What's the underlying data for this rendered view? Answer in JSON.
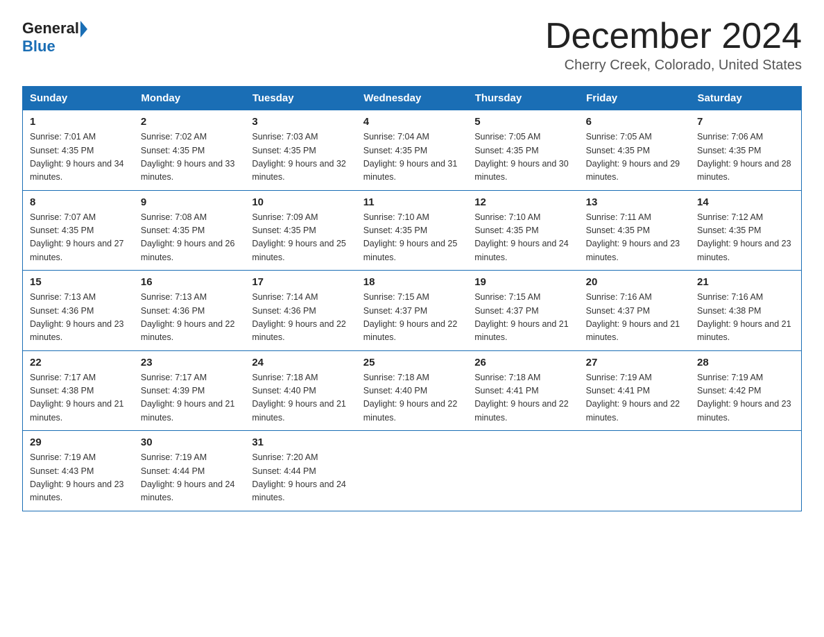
{
  "logo": {
    "general": "General",
    "blue": "Blue"
  },
  "title": "December 2024",
  "subtitle": "Cherry Creek, Colorado, United States",
  "days_of_week": [
    "Sunday",
    "Monday",
    "Tuesday",
    "Wednesday",
    "Thursday",
    "Friday",
    "Saturday"
  ],
  "weeks": [
    [
      {
        "day": "1",
        "sunrise": "7:01 AM",
        "sunset": "4:35 PM",
        "daylight": "9 hours and 34 minutes."
      },
      {
        "day": "2",
        "sunrise": "7:02 AM",
        "sunset": "4:35 PM",
        "daylight": "9 hours and 33 minutes."
      },
      {
        "day": "3",
        "sunrise": "7:03 AM",
        "sunset": "4:35 PM",
        "daylight": "9 hours and 32 minutes."
      },
      {
        "day": "4",
        "sunrise": "7:04 AM",
        "sunset": "4:35 PM",
        "daylight": "9 hours and 31 minutes."
      },
      {
        "day": "5",
        "sunrise": "7:05 AM",
        "sunset": "4:35 PM",
        "daylight": "9 hours and 30 minutes."
      },
      {
        "day": "6",
        "sunrise": "7:05 AM",
        "sunset": "4:35 PM",
        "daylight": "9 hours and 29 minutes."
      },
      {
        "day": "7",
        "sunrise": "7:06 AM",
        "sunset": "4:35 PM",
        "daylight": "9 hours and 28 minutes."
      }
    ],
    [
      {
        "day": "8",
        "sunrise": "7:07 AM",
        "sunset": "4:35 PM",
        "daylight": "9 hours and 27 minutes."
      },
      {
        "day": "9",
        "sunrise": "7:08 AM",
        "sunset": "4:35 PM",
        "daylight": "9 hours and 26 minutes."
      },
      {
        "day": "10",
        "sunrise": "7:09 AM",
        "sunset": "4:35 PM",
        "daylight": "9 hours and 25 minutes."
      },
      {
        "day": "11",
        "sunrise": "7:10 AM",
        "sunset": "4:35 PM",
        "daylight": "9 hours and 25 minutes."
      },
      {
        "day": "12",
        "sunrise": "7:10 AM",
        "sunset": "4:35 PM",
        "daylight": "9 hours and 24 minutes."
      },
      {
        "day": "13",
        "sunrise": "7:11 AM",
        "sunset": "4:35 PM",
        "daylight": "9 hours and 23 minutes."
      },
      {
        "day": "14",
        "sunrise": "7:12 AM",
        "sunset": "4:35 PM",
        "daylight": "9 hours and 23 minutes."
      }
    ],
    [
      {
        "day": "15",
        "sunrise": "7:13 AM",
        "sunset": "4:36 PM",
        "daylight": "9 hours and 23 minutes."
      },
      {
        "day": "16",
        "sunrise": "7:13 AM",
        "sunset": "4:36 PM",
        "daylight": "9 hours and 22 minutes."
      },
      {
        "day": "17",
        "sunrise": "7:14 AM",
        "sunset": "4:36 PM",
        "daylight": "9 hours and 22 minutes."
      },
      {
        "day": "18",
        "sunrise": "7:15 AM",
        "sunset": "4:37 PM",
        "daylight": "9 hours and 22 minutes."
      },
      {
        "day": "19",
        "sunrise": "7:15 AM",
        "sunset": "4:37 PM",
        "daylight": "9 hours and 21 minutes."
      },
      {
        "day": "20",
        "sunrise": "7:16 AM",
        "sunset": "4:37 PM",
        "daylight": "9 hours and 21 minutes."
      },
      {
        "day": "21",
        "sunrise": "7:16 AM",
        "sunset": "4:38 PM",
        "daylight": "9 hours and 21 minutes."
      }
    ],
    [
      {
        "day": "22",
        "sunrise": "7:17 AM",
        "sunset": "4:38 PM",
        "daylight": "9 hours and 21 minutes."
      },
      {
        "day": "23",
        "sunrise": "7:17 AM",
        "sunset": "4:39 PM",
        "daylight": "9 hours and 21 minutes."
      },
      {
        "day": "24",
        "sunrise": "7:18 AM",
        "sunset": "4:40 PM",
        "daylight": "9 hours and 21 minutes."
      },
      {
        "day": "25",
        "sunrise": "7:18 AM",
        "sunset": "4:40 PM",
        "daylight": "9 hours and 22 minutes."
      },
      {
        "day": "26",
        "sunrise": "7:18 AM",
        "sunset": "4:41 PM",
        "daylight": "9 hours and 22 minutes."
      },
      {
        "day": "27",
        "sunrise": "7:19 AM",
        "sunset": "4:41 PM",
        "daylight": "9 hours and 22 minutes."
      },
      {
        "day": "28",
        "sunrise": "7:19 AM",
        "sunset": "4:42 PM",
        "daylight": "9 hours and 23 minutes."
      }
    ],
    [
      {
        "day": "29",
        "sunrise": "7:19 AM",
        "sunset": "4:43 PM",
        "daylight": "9 hours and 23 minutes."
      },
      {
        "day": "30",
        "sunrise": "7:19 AM",
        "sunset": "4:44 PM",
        "daylight": "9 hours and 24 minutes."
      },
      {
        "day": "31",
        "sunrise": "7:20 AM",
        "sunset": "4:44 PM",
        "daylight": "9 hours and 24 minutes."
      },
      null,
      null,
      null,
      null
    ]
  ]
}
